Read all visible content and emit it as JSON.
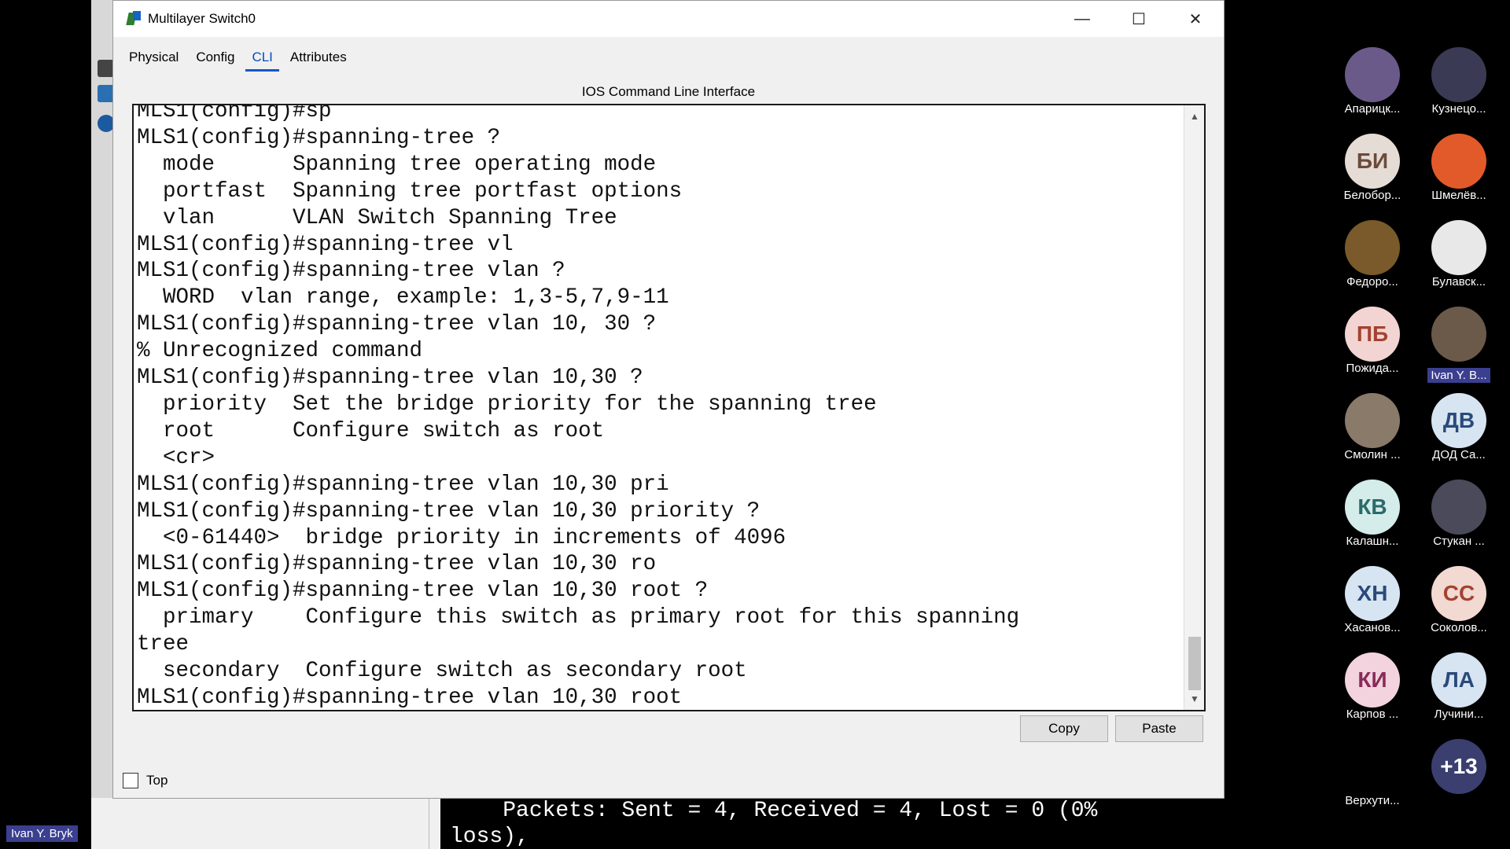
{
  "window": {
    "title": "Multilayer Switch0",
    "controls": {
      "minimize": "—",
      "maximize": "☐",
      "close": "✕"
    }
  },
  "tabs": [
    {
      "label": "Physical",
      "active": false
    },
    {
      "label": "Config",
      "active": false
    },
    {
      "label": "CLI",
      "active": true
    },
    {
      "label": "Attributes",
      "active": false
    }
  ],
  "cli": {
    "heading": "IOS Command Line Interface",
    "lines": [
      "MLS1(config)#sp",
      "MLS1(config)#spanning-tree ?",
      "  mode      Spanning tree operating mode",
      "  portfast  Spanning tree portfast options",
      "  vlan      VLAN Switch Spanning Tree",
      "MLS1(config)#spanning-tree vl",
      "MLS1(config)#spanning-tree vlan ?",
      "  WORD  vlan range, example: 1,3-5,7,9-11",
      "MLS1(config)#spanning-tree vlan 10, 30 ?",
      "% Unrecognized command",
      "MLS1(config)#spanning-tree vlan 10,30 ?",
      "  priority  Set the bridge priority for the spanning tree",
      "  root      Configure switch as root",
      "  <cr>",
      "MLS1(config)#spanning-tree vlan 10,30 pri",
      "MLS1(config)#spanning-tree vlan 10,30 priority ?",
      "  <0-61440>  bridge priority in increments of 4096",
      "MLS1(config)#spanning-tree vlan 10,30 ro",
      "MLS1(config)#spanning-tree vlan 10,30 root ?",
      "  primary    Configure this switch as primary root for this spanning",
      "tree",
      "  secondary  Configure switch as secondary root",
      "MLS1(config)#spanning-tree vlan 10,30 root "
    ],
    "copy_label": "Copy",
    "paste_label": "Paste",
    "top_label": "Top"
  },
  "background_terminal": {
    "line1": "    Packets: Sent = 4, Received = 4, Lost = 0 (0%",
    "line2": "loss),"
  },
  "participants": [
    {
      "name": "Апарицк...",
      "initials": "",
      "color": "#6a5a8a"
    },
    {
      "name": "Кузнецо...",
      "initials": "",
      "color": "#3a3a55"
    },
    {
      "name": "Белобор...",
      "initials": "БИ",
      "color": "#e6dcd6",
      "text_color": "#6b4b3b"
    },
    {
      "name": "Шмелёв...",
      "initials": "",
      "color": "#e25a2a"
    },
    {
      "name": "Федоро...",
      "initials": "",
      "color": "#7a5a2a"
    },
    {
      "name": "Булавск...",
      "initials": "",
      "color": "#e8e8e8"
    },
    {
      "name": "Пожида...",
      "initials": "ПБ",
      "color": "#f2d5d2",
      "text_color": "#a44232"
    },
    {
      "name": "Ivan Y. B...",
      "initials": "",
      "color": "#6b5a4a",
      "highlight": true
    },
    {
      "name": "Смолин ...",
      "initials": "",
      "color": "#8a7a6a"
    },
    {
      "name": "ДОД Са...",
      "initials": "ДВ",
      "color": "#d7e5f2",
      "text_color": "#2a4a7a"
    },
    {
      "name": "Калашн...",
      "initials": "КВ",
      "color": "#d4ecea",
      "text_color": "#2a6a6a"
    },
    {
      "name": "Стукан ...",
      "initials": "",
      "color": "#4a4a5a"
    },
    {
      "name": "Хасанов...",
      "initials": "ХН",
      "color": "#d7e5f2",
      "text_color": "#2a4a7a"
    },
    {
      "name": "Соколов...",
      "initials": "СС",
      "color": "#f2d9d2",
      "text_color": "#a44232"
    },
    {
      "name": "Карпов ...",
      "initials": "КИ",
      "color": "#f2d3de",
      "text_color": "#8a2a5a"
    },
    {
      "name": "Лучини...",
      "initials": "ЛА",
      "color": "#d7e5f2",
      "text_color": "#2a4a7a"
    },
    {
      "name": "Верхути...",
      "initials": "",
      "color": "#000000"
    },
    {
      "name": "",
      "initials": "+13",
      "color": "#3b3f6f",
      "text_color": "#ffffff"
    }
  ],
  "self_label": "Ivan Y. Bryk"
}
